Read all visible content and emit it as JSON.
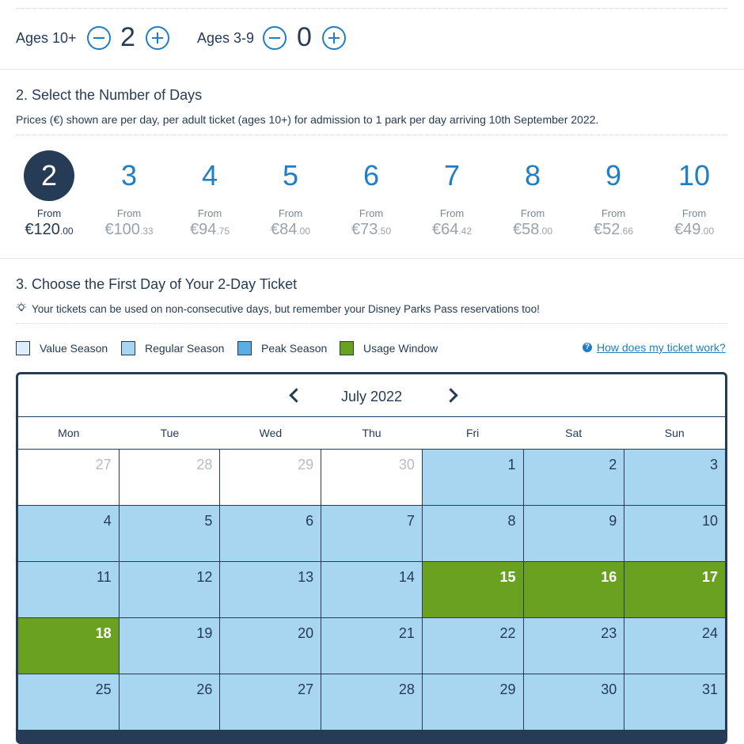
{
  "ages": {
    "adult_label": "Ages 10+",
    "adult_count": "2",
    "child_label": "Ages 3-9",
    "child_count": "0"
  },
  "days_section": {
    "title": "2. Select the Number of Days",
    "subtitle": "Prices (€) shown are per day, per adult ticket (ages 10+) for admission to 1 park per day arriving 10th September 2022.",
    "options": [
      {
        "days": "2",
        "from": "From",
        "euros": "€120",
        "cents": ".00",
        "selected": true
      },
      {
        "days": "3",
        "from": "From",
        "euros": "€100",
        "cents": ".33"
      },
      {
        "days": "4",
        "from": "From",
        "euros": "€94",
        "cents": ".75"
      },
      {
        "days": "5",
        "from": "From",
        "euros": "€84",
        "cents": ".00"
      },
      {
        "days": "6",
        "from": "From",
        "euros": "€73",
        "cents": ".50"
      },
      {
        "days": "7",
        "from": "From",
        "euros": "€64",
        "cents": ".42"
      },
      {
        "days": "8",
        "from": "From",
        "euros": "€58",
        "cents": ".00"
      },
      {
        "days": "9",
        "from": "From",
        "euros": "€52",
        "cents": ".66"
      },
      {
        "days": "10",
        "from": "From",
        "euros": "€49",
        "cents": ".00"
      }
    ]
  },
  "first_day_section": {
    "title": "3. Choose the First Day of Your 2-Day Ticket",
    "tip_icon": "lightbulb-icon",
    "tip": "Your tickets can be used on non-consecutive days, but remember your Disney Parks Pass reservations too!"
  },
  "legend": {
    "items": [
      {
        "label": "Value Season",
        "color": "#dbeefa"
      },
      {
        "label": "Regular Season",
        "color": "#a8d6f0"
      },
      {
        "label": "Peak Season",
        "color": "#5aaee2"
      },
      {
        "label": "Usage Window",
        "color": "#6aa121"
      }
    ],
    "help_icon": "question-circle-icon",
    "help_link": "How does my ticket work?"
  },
  "calendar": {
    "month": "July 2022",
    "weekdays": [
      "Mon",
      "Tue",
      "Wed",
      "Thu",
      "Fri",
      "Sat",
      "Sun"
    ],
    "cells": [
      {
        "day": "27",
        "state": "out"
      },
      {
        "day": "28",
        "state": "out"
      },
      {
        "day": "29",
        "state": "out"
      },
      {
        "day": "30",
        "state": "out"
      },
      {
        "day": "1",
        "state": "regular"
      },
      {
        "day": "2",
        "state": "regular"
      },
      {
        "day": "3",
        "state": "regular"
      },
      {
        "day": "4",
        "state": "regular"
      },
      {
        "day": "5",
        "state": "regular"
      },
      {
        "day": "6",
        "state": "regular"
      },
      {
        "day": "7",
        "state": "regular"
      },
      {
        "day": "8",
        "state": "regular"
      },
      {
        "day": "9",
        "state": "regular"
      },
      {
        "day": "10",
        "state": "regular"
      },
      {
        "day": "11",
        "state": "regular"
      },
      {
        "day": "12",
        "state": "regular"
      },
      {
        "day": "13",
        "state": "regular"
      },
      {
        "day": "14",
        "state": "regular"
      },
      {
        "day": "15",
        "state": "usage"
      },
      {
        "day": "16",
        "state": "usage"
      },
      {
        "day": "17",
        "state": "usage"
      },
      {
        "day": "18",
        "state": "usage"
      },
      {
        "day": "19",
        "state": "regular"
      },
      {
        "day": "20",
        "state": "regular"
      },
      {
        "day": "21",
        "state": "regular"
      },
      {
        "day": "22",
        "state": "regular"
      },
      {
        "day": "23",
        "state": "regular"
      },
      {
        "day": "24",
        "state": "regular"
      },
      {
        "day": "25",
        "state": "regular"
      },
      {
        "day": "26",
        "state": "regular"
      },
      {
        "day": "27",
        "state": "regular"
      },
      {
        "day": "28",
        "state": "regular"
      },
      {
        "day": "29",
        "state": "regular"
      },
      {
        "day": "30",
        "state": "regular"
      },
      {
        "day": "31",
        "state": "regular"
      }
    ]
  }
}
